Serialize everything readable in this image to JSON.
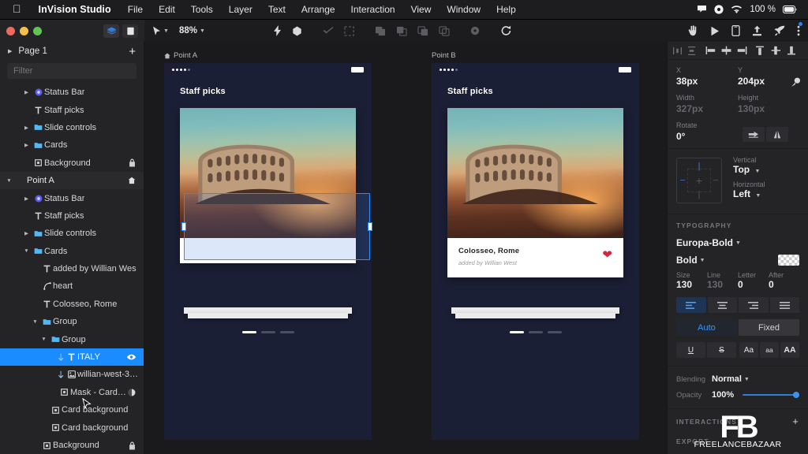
{
  "menubar": {
    "apple_icon": "apple-logo",
    "app_name": "InVision Studio",
    "items": [
      "File",
      "Edit",
      "Tools",
      "Layer",
      "Text",
      "Arrange",
      "Interaction",
      "View",
      "Window",
      "Help"
    ],
    "status": {
      "battery_percent": "100 %",
      "icons": [
        "notification-icon",
        "record-icon",
        "wifi-icon",
        "battery-icon"
      ]
    }
  },
  "toolbar": {
    "cursor_tool": "cursor-tool-icon",
    "zoom_level": "88%",
    "icons_left": [
      "lightning-icon",
      "component-icon",
      "smart-connect-icon",
      "grid-icon"
    ],
    "icons_mid": [
      "union-icon",
      "subtract-icon",
      "intersect-icon",
      "difference-icon",
      "flatten-icon",
      "rotate-icon"
    ],
    "icons_right": [
      "hand-icon",
      "play-icon",
      "device-icon",
      "upload-icon",
      "rocket-icon",
      "more-icon"
    ]
  },
  "left_panel": {
    "view_toggle_icons": [
      "layers-view-icon",
      "assets-view-icon"
    ],
    "page": {
      "name": "Page 1",
      "add_label": "+"
    },
    "filter": {
      "placeholder": "Filter",
      "value": ""
    },
    "layers": [
      {
        "label": "Status Bar",
        "indent": 2,
        "icon": "component-icon",
        "disc": "collapsed",
        "trail": "",
        "selected": false,
        "section": false,
        "link": false
      },
      {
        "label": "Staff picks",
        "indent": 2,
        "icon": "text-icon",
        "disc": "none",
        "trail": "",
        "selected": false,
        "section": false,
        "link": false
      },
      {
        "label": "Slide controls",
        "indent": 2,
        "icon": "folder-icon",
        "disc": "collapsed",
        "trail": "",
        "selected": false,
        "section": false,
        "link": false
      },
      {
        "label": "Cards",
        "indent": 2,
        "icon": "folder-icon",
        "disc": "collapsed",
        "trail": "",
        "selected": false,
        "section": false,
        "link": false
      },
      {
        "label": "Background",
        "indent": 2,
        "icon": "shape-icon",
        "disc": "none",
        "trail": "lock",
        "selected": false,
        "section": false,
        "link": false
      },
      {
        "label": "Point A",
        "indent": 0,
        "icon": "none",
        "disc": "expanded",
        "trail": "home",
        "selected": false,
        "section": true,
        "link": false
      },
      {
        "label": "Status Bar",
        "indent": 2,
        "icon": "component-icon",
        "disc": "collapsed",
        "trail": "",
        "selected": false,
        "section": false,
        "link": false
      },
      {
        "label": "Staff picks",
        "indent": 2,
        "icon": "text-icon",
        "disc": "none",
        "trail": "",
        "selected": false,
        "section": false,
        "link": false
      },
      {
        "label": "Slide controls",
        "indent": 2,
        "icon": "folder-icon",
        "disc": "collapsed",
        "trail": "",
        "selected": false,
        "section": false,
        "link": false
      },
      {
        "label": "Cards",
        "indent": 2,
        "icon": "folder-icon",
        "disc": "expanded",
        "trail": "",
        "selected": false,
        "section": false,
        "link": false
      },
      {
        "label": "added by Willian Wes",
        "indent": 3,
        "icon": "text-icon",
        "disc": "none",
        "trail": "",
        "selected": false,
        "section": false,
        "link": false
      },
      {
        "label": "heart",
        "indent": 3,
        "icon": "path-icon",
        "disc": "none",
        "trail": "",
        "selected": false,
        "section": false,
        "link": false
      },
      {
        "label": "Colosseo, Rome",
        "indent": 3,
        "icon": "text-icon",
        "disc": "none",
        "trail": "",
        "selected": false,
        "section": false,
        "link": false
      },
      {
        "label": "Group",
        "indent": 3,
        "icon": "folder-icon",
        "disc": "expanded",
        "trail": "",
        "selected": false,
        "section": false,
        "link": false
      },
      {
        "label": "Group",
        "indent": 4,
        "icon": "folder-icon",
        "disc": "expanded",
        "trail": "",
        "selected": false,
        "section": false,
        "link": false
      },
      {
        "label": "ITALY",
        "indent": 5,
        "icon": "text-icon",
        "disc": "none",
        "trail": "eye",
        "selected": true,
        "section": false,
        "link": true
      },
      {
        "label": "willian-west-3…",
        "indent": 5,
        "icon": "image-icon",
        "disc": "none",
        "trail": "",
        "selected": false,
        "section": false,
        "link": true
      },
      {
        "label": "Mask - Card b…",
        "indent": 5,
        "icon": "shape-icon",
        "disc": "none",
        "trail": "mask",
        "selected": false,
        "section": false,
        "link": false
      },
      {
        "label": "Card background",
        "indent": 4,
        "icon": "shape-icon",
        "disc": "none",
        "trail": "",
        "selected": false,
        "section": false,
        "link": false
      },
      {
        "label": "Card background",
        "indent": 4,
        "icon": "shape-icon",
        "disc": "none",
        "trail": "",
        "selected": false,
        "section": false,
        "link": false
      },
      {
        "label": "Background",
        "indent": 3,
        "icon": "shape-icon",
        "disc": "none",
        "trail": "lock",
        "selected": false,
        "section": false,
        "link": false
      }
    ]
  },
  "canvas": {
    "artboards": [
      {
        "name": "Point A",
        "has_home_icon": true,
        "heading": "Staff picks",
        "card": {
          "title": "",
          "subtitle": "",
          "show_body_text": false
        },
        "pager": {
          "total": 3,
          "active": 0
        }
      },
      {
        "name": "Point B",
        "has_home_icon": false,
        "heading": "Staff picks",
        "card": {
          "title": "Colosseo, Rome",
          "subtitle": "added by Willian West",
          "show_body_text": true
        },
        "pager": {
          "total": 3,
          "active": 0
        }
      }
    ]
  },
  "right_panel": {
    "geometry": {
      "x_label": "X",
      "x_value": "38px",
      "y_label": "Y",
      "y_value": "204px",
      "width_label": "Width",
      "width_value": "327px",
      "height_label": "Height",
      "height_value": "130px",
      "rotate_label": "Rotate",
      "rotate_value": "0°"
    },
    "alignment": {
      "vertical_label": "Vertical",
      "vertical_value": "Top",
      "horizontal_label": "Horizontal",
      "horizontal_value": "Left"
    },
    "typography": {
      "section_title": "TYPOGRAPHY",
      "font_family": "Europa-Bold",
      "font_weight": "Bold",
      "size_label": "Size",
      "size_value": "130",
      "line_label": "Line",
      "line_value": "130",
      "letter_label": "Letter",
      "letter_value": "0",
      "after_label": "After",
      "after_value": "0",
      "fit_auto": "Auto",
      "fit_fixed": "Fixed",
      "style_underline": "U",
      "style_strikethrough": "S",
      "case_title": "Aa",
      "case_lower": "aa",
      "case_upper": "AA"
    },
    "blending": {
      "blending_label": "Blending",
      "blending_value": "Normal",
      "opacity_label": "Opacity",
      "opacity_value": "100%"
    },
    "interactions": {
      "section_title": "INTERACTIONS",
      "add_label": "+"
    },
    "export": {
      "section_title": "EXPORT"
    }
  },
  "watermark": {
    "mark": "FB",
    "text": "FREELANCEBAZAAR"
  },
  "colors": {
    "accent_blue": "#1a8cff",
    "panel_bg": "#242426",
    "canvas_bg": "#1a1a1c",
    "artboard_bg": "#1b1f35",
    "heart_red": "#d9233b"
  }
}
